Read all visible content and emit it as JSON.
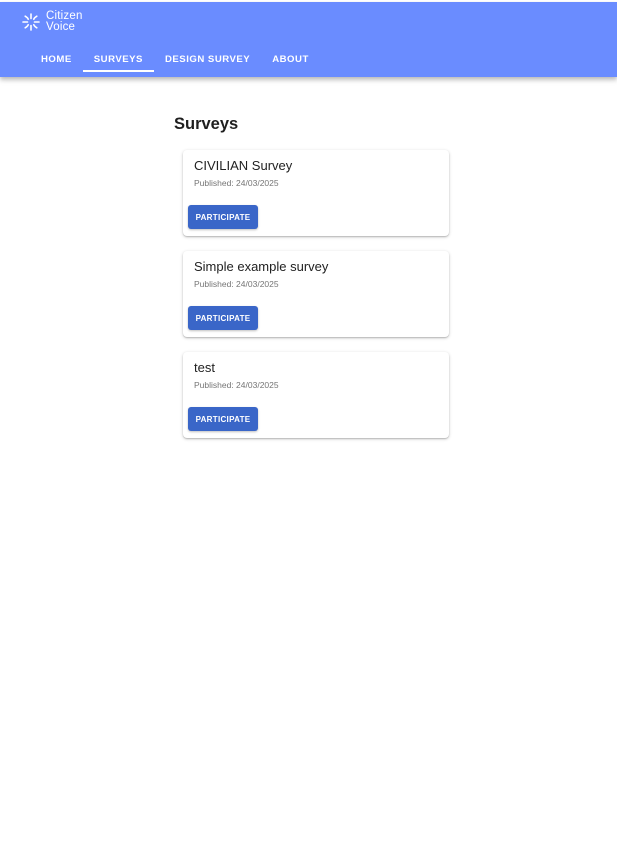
{
  "app": {
    "logo_line1": "Citizen",
    "logo_line2": "Voice",
    "logo_icon": "sparkle-burst-icon"
  },
  "nav": {
    "items": [
      {
        "label": "HOME",
        "active": false
      },
      {
        "label": "SURVEYS",
        "active": true
      },
      {
        "label": "DESIGN SURVEY",
        "active": false
      },
      {
        "label": "ABOUT",
        "active": false
      }
    ]
  },
  "main": {
    "title": "Surveys",
    "surveys": [
      {
        "title": "CIVILIAN Survey",
        "published": "Published: 24/03/2025",
        "button_label": "PARTICIPATE"
      },
      {
        "title": "Simple example survey",
        "published": "Published: 24/03/2025",
        "button_label": "PARTICIPATE"
      },
      {
        "title": "test",
        "published": "Published: 24/03/2025",
        "button_label": "PARTICIPATE"
      }
    ]
  },
  "colors": {
    "appbar": "#6a8cff",
    "button": "#3a66c8",
    "title_text": "#1f1f1f",
    "muted_text": "#757575"
  }
}
